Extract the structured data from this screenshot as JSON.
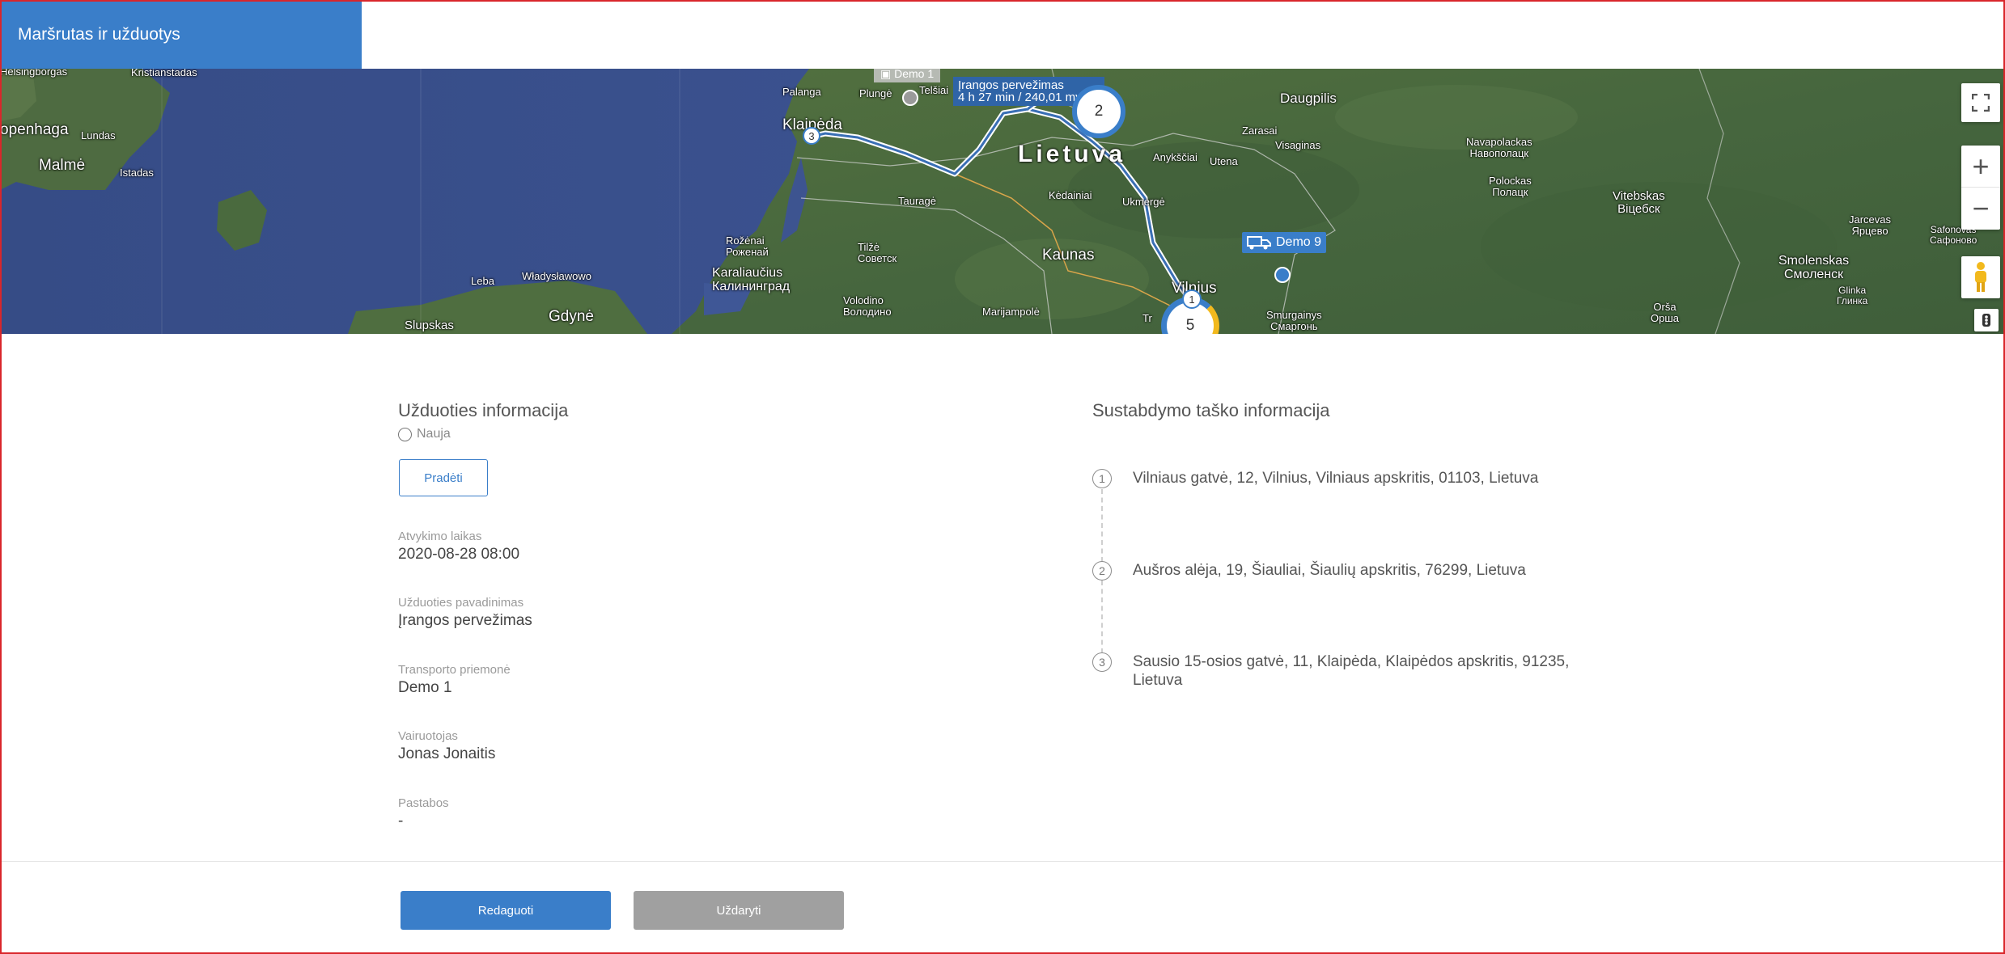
{
  "header": {
    "title": "Maršrutas ir užduotys"
  },
  "map": {
    "places": {
      "helsingborgas": "Helsingborgas",
      "kristianstadas": "Kristianstadas",
      "copenhaga": "openhaga",
      "lundas": "Lundas",
      "malme": "Malmė",
      "istadas": "Istadas",
      "palanga": "Palanga",
      "plunge": "Plungė",
      "telsiai": "Telšiai",
      "klaipeda": "Klaipėda",
      "taurage": "Tauragė",
      "rozenai": "Rožėnai\nРоженай",
      "tilze": "Tilžė\nСоветск",
      "karaliaucius": "Karaliaučius\nКалининград",
      "leba": "Leba",
      "wladyslawowo": "Władysławowo",
      "gdyne": "Gdynė",
      "slupskas": "Slupskas",
      "volodino": "Volodino\nВолодино",
      "marijampole": "Marijampolė",
      "kaunas": "Kaunas",
      "kedainiai": "Kėdainiai",
      "ukmerge": "Ukmergė",
      "anyksciai": "Anykščiai",
      "utena": "Utena",
      "zarasai": "Zarasai",
      "visaginas": "Visaginas",
      "daugpilis": "Daugpilis",
      "navapolackas": "Navapolackas\nНавополацк",
      "polockas": "Polockas\nПолацк",
      "vitebskas": "Vitebskas\nВіцебск",
      "jarcevas": "Jarcevas\nЯрцево",
      "safonovas": "Safonovas\nСафоново",
      "smolenskas": "Smolenskas\nСмоленск",
      "glinka": "Glinka\nГлинка",
      "orsa": "Orša\nОрша",
      "smurgainys": "Smurgainys\nСмаргонь",
      "lietuva": "Lietuva",
      "vilnius": "Vilnius",
      "trakai": "Tr"
    },
    "route_tooltip": {
      "title": "Įrangos pervežimas",
      "detail": "4 h 27 min / 240,01 mylios"
    },
    "vehicle_label": "Demo 9",
    "top_vehicle_label": "Demo 1",
    "cluster_2": "2",
    "cluster_5": "5",
    "pin_1": "1",
    "pin_3": "3",
    "controls": {
      "fullscreen": "⛶",
      "zoom_in": "+",
      "zoom_out": "−"
    },
    "colors": {
      "water": "#3d5490",
      "land": "#4a6a40",
      "route": "#3a6fb5"
    }
  },
  "task_info": {
    "title": "Užduoties informacija",
    "status": "Nauja",
    "start_button": "Pradėti",
    "fields": [
      {
        "label": "Atvykimo laikas",
        "value": "2020-08-28 08:00"
      },
      {
        "label": "Užduoties pavadinimas",
        "value": "Įrangos pervežimas"
      },
      {
        "label": "Transporto priemonė",
        "value": "Demo 1"
      },
      {
        "label": "Vairuotojas",
        "value": "Jonas Jonaitis"
      },
      {
        "label": "Pastabos",
        "value": "-"
      }
    ]
  },
  "stop_info": {
    "title": "Sustabdymo taško informacija",
    "stops": [
      {
        "num": "1",
        "address": "Vilniaus gatvė, 12, Vilnius, Vilniaus apskritis, 01103, Lietuva"
      },
      {
        "num": "2",
        "address": "Aušros alėja, 19, Šiauliai, Šiaulių apskritis, 76299, Lietuva"
      },
      {
        "num": "3",
        "address": "Sausio 15-osios gatvė, 11, Klaipėda, Klaipėdos apskritis, 91235, Lietuva"
      }
    ]
  },
  "footer": {
    "edit_button": "Redaguoti",
    "close_button": "Uždaryti",
    "primary_color": "#3a7ec9",
    "secondary_color": "#a0a0a0"
  }
}
